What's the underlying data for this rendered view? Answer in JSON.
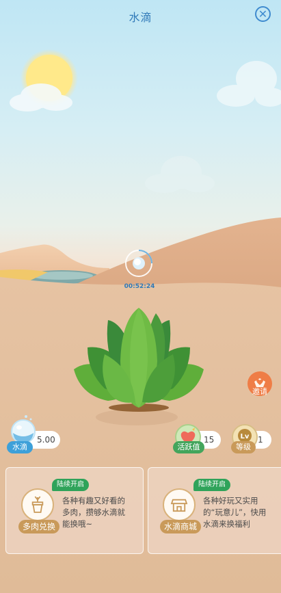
{
  "header": {
    "title": "水滴",
    "close_icon": "close-circle-icon"
  },
  "timer": "00:52:24",
  "stats": {
    "water": {
      "label": "水滴",
      "value": "5.00"
    },
    "activity": {
      "label": "活跃值",
      "value": "15"
    },
    "level": {
      "label": "等级",
      "value": "1",
      "icon_text": "Lv"
    }
  },
  "invite": {
    "label": "邀请"
  },
  "cards": [
    {
      "badge": "陆续开启",
      "label": "多肉兑换",
      "desc_lines": [
        "各种有趣又好看的",
        "多肉，攒够水滴就",
        "能换哦~"
      ],
      "icon": "plant-pot-icon"
    },
    {
      "badge": "陆续开启",
      "label": "水滴商城",
      "desc_lines": [
        "各种好玩又实用",
        "的“玩意儿”，快用",
        "水滴来换福利"
      ],
      "icon": "shop-icon"
    }
  ],
  "colors": {
    "accent_blue": "#2f79b8",
    "green_badge": "#2fa35a",
    "tan_label": "#c99a5a",
    "invite_orange": "#ef7d46"
  }
}
